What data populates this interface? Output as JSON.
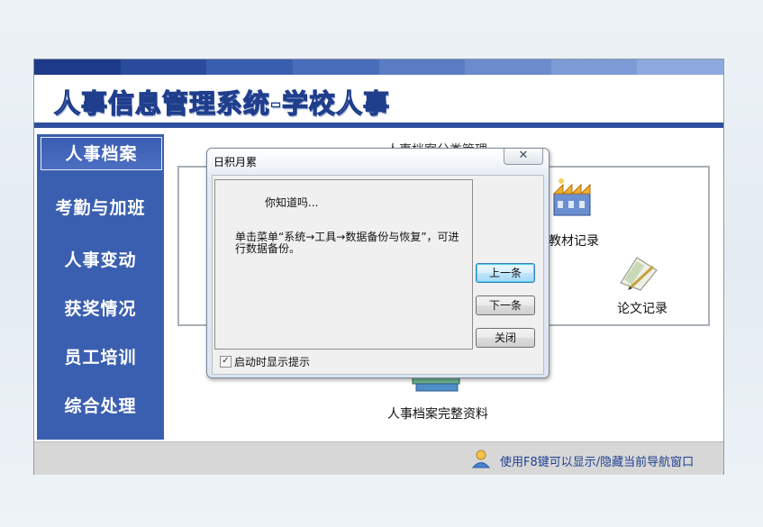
{
  "app": {
    "title": "人事信息管理系统-学校人事",
    "band_colors": [
      "#1d3b8a",
      "#2b4c9c",
      "#3a5eaf",
      "#4a6dbb",
      "#5a7cc4",
      "#6b8bcd",
      "#7d9bd6",
      "#8ea9dd"
    ]
  },
  "sidebar": {
    "items": [
      {
        "label": "人事档案",
        "active": true
      },
      {
        "label": "考勤与加班"
      },
      {
        "label": "人事变动"
      },
      {
        "label": "获奖情况"
      },
      {
        "label": "员工培训"
      },
      {
        "label": "综合处理"
      }
    ]
  },
  "main": {
    "caption": "人事档案分类管理",
    "items": {
      "textbook": "教材记录",
      "thesis": "论文记录",
      "full": "人事档案完整资料"
    }
  },
  "status": {
    "text": "使用F8键可以显示/隐藏当前导航窗口"
  },
  "dialog": {
    "title": "日积月累",
    "close": "✕",
    "tip_heading": "你知道吗...",
    "tip_body": "单击菜单“系统→工具→数据备份与恢复”，可进行数据备份。",
    "buttons": {
      "prev": "上一条",
      "next": "下一条",
      "close": "关闭"
    },
    "checkbox_label": "启动时显示提示",
    "checkbox_checked": true
  }
}
